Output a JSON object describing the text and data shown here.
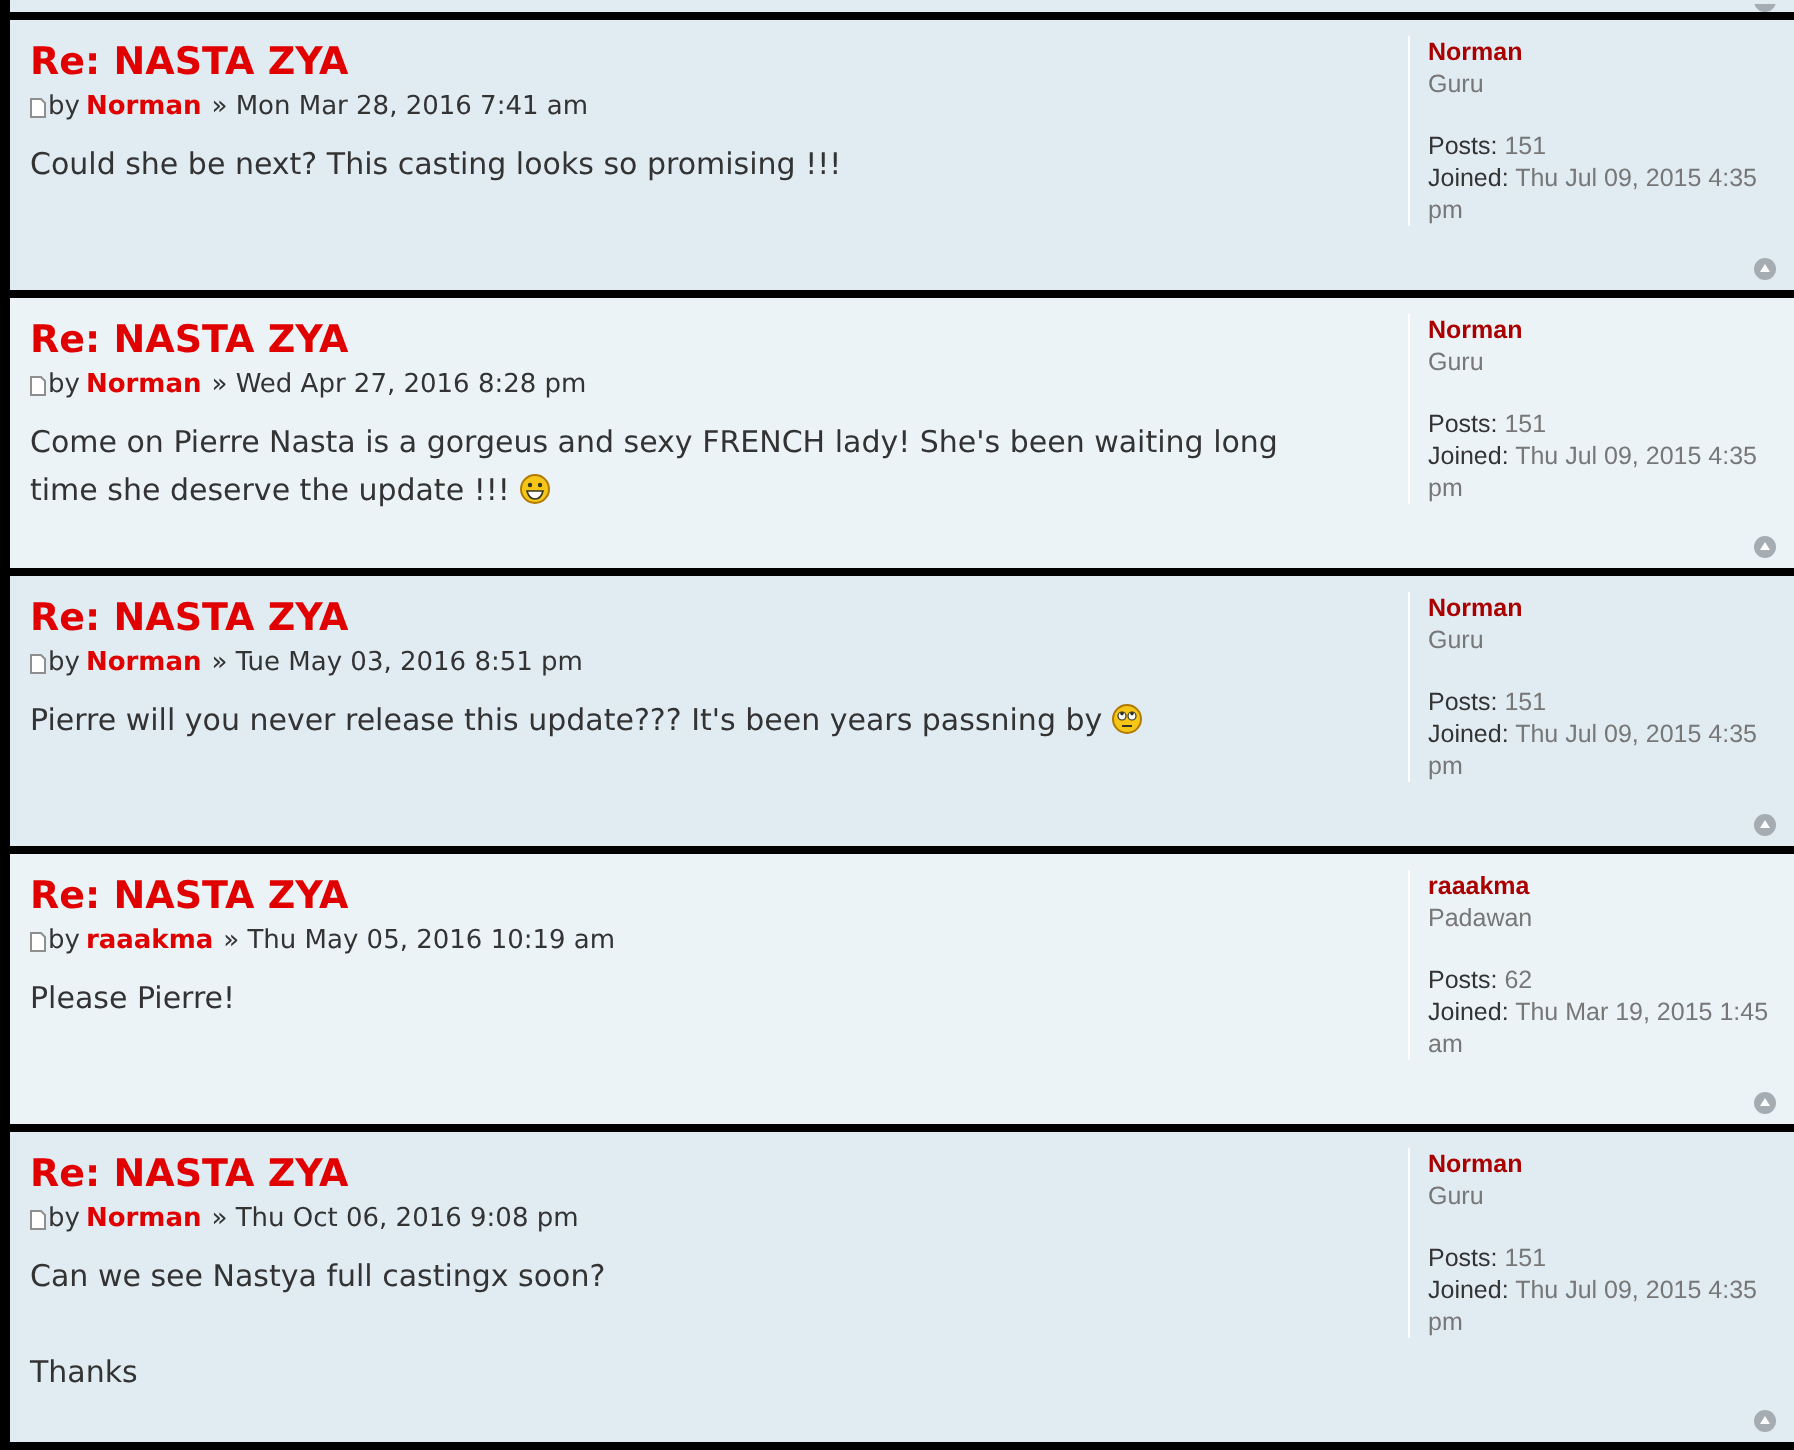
{
  "posts": [
    {
      "title": "Re: NASTA ZYA",
      "by": "by",
      "author": "Norman",
      "date": "» Mon Mar 28, 2016 7:41 am",
      "content": [
        {
          "text": "Could she be next? This casting looks so promising !!!"
        }
      ],
      "profile": {
        "name": "Norman",
        "rank": "Guru",
        "posts_label": "Posts:",
        "posts": "151",
        "joined_label": "Joined:",
        "joined": "Thu Jul 09, 2015 4:35 pm"
      }
    },
    {
      "title": "Re: NASTA ZYA",
      "by": "by",
      "author": "Norman",
      "date": "» Wed Apr 27, 2016 8:28 pm",
      "content": [
        {
          "kind": "grin",
          "lines": [
            "Come on Pierre Nasta is a gorgeus and sexy FRENCH lady! She's been waiting long",
            "time she deserve the update !!!"
          ]
        }
      ],
      "profile": {
        "name": "Norman",
        "rank": "Guru",
        "posts_label": "Posts:",
        "posts": "151",
        "joined_label": "Joined:",
        "joined": "Thu Jul 09, 2015 4:35 pm"
      }
    },
    {
      "title": "Re: NASTA ZYA",
      "by": "by",
      "author": "Norman",
      "date": "» Tue May 03, 2016 8:51 pm",
      "content": [
        {
          "kind": "rolleyes",
          "text": "Pierre will you never release this update??? It's been years passning by"
        }
      ],
      "profile": {
        "name": "Norman",
        "rank": "Guru",
        "posts_label": "Posts:",
        "posts": "151",
        "joined_label": "Joined:",
        "joined": "Thu Jul 09, 2015 4:35 pm"
      }
    },
    {
      "title": "Re: NASTA ZYA",
      "by": "by",
      "author": "raaakma",
      "date": "» Thu May 05, 2016 10:19 am",
      "content": [
        {
          "text": "Please Pierre!"
        }
      ],
      "profile": {
        "name": "raaakma",
        "rank": "Padawan",
        "posts_label": "Posts:",
        "posts": "62",
        "joined_label": "Joined:",
        "joined": "Thu Mar 19, 2015 1:45 am"
      }
    },
    {
      "title": "Re: NASTA ZYA",
      "by": "by",
      "author": "Norman",
      "date": "» Thu Oct 06, 2016 9:08 pm",
      "content": [
        {
          "text": "Can we see Nastya full castingx soon?"
        },
        {
          "text": "Thanks"
        }
      ],
      "profile": {
        "name": "Norman",
        "rank": "Guru",
        "posts_label": "Posts:",
        "posts": "151",
        "joined_label": "Joined:",
        "joined": "Thu Jul 09, 2015 4:35 pm"
      }
    }
  ]
}
